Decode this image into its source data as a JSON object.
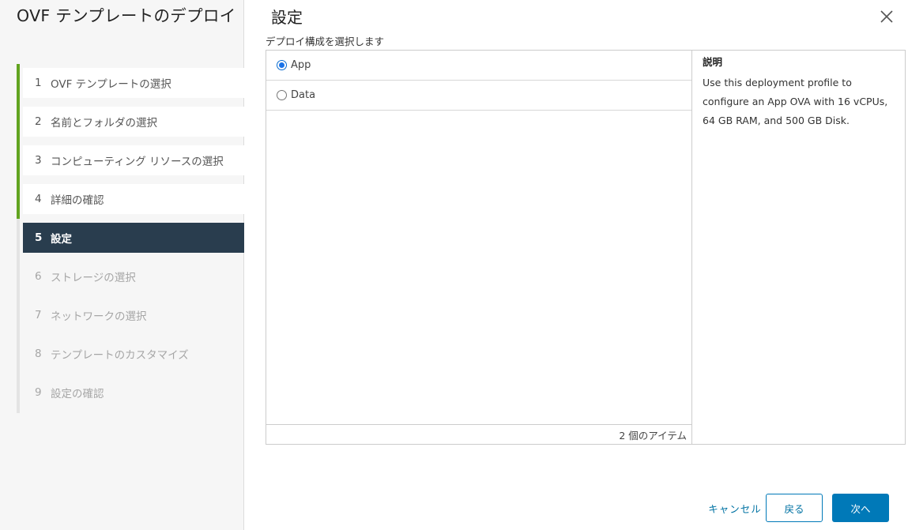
{
  "wizard": {
    "title": "OVF テンプレートのデプロイ"
  },
  "steps": [
    {
      "num": "1",
      "label": "OVF テンプレートの選択",
      "state": "completed"
    },
    {
      "num": "2",
      "label": "名前とフォルダの選択",
      "state": "completed"
    },
    {
      "num": "3",
      "label": "コンピューティング リソースの選択",
      "state": "completed"
    },
    {
      "num": "4",
      "label": "詳細の確認",
      "state": "completed"
    },
    {
      "num": "5",
      "label": "設定",
      "state": "current"
    },
    {
      "num": "6",
      "label": "ストレージの選択",
      "state": "upcoming"
    },
    {
      "num": "7",
      "label": "ネットワークの選択",
      "state": "upcoming"
    },
    {
      "num": "8",
      "label": "テンプレートのカスタマイズ",
      "state": "upcoming"
    },
    {
      "num": "9",
      "label": "設定の確認",
      "state": "upcoming"
    }
  ],
  "page": {
    "title": "設定",
    "instruction": "デプロイ構成を選択します"
  },
  "config": {
    "options": [
      {
        "label": "App",
        "selected": true
      },
      {
        "label": "Data",
        "selected": false
      }
    ],
    "item_count": "2 個のアイテム"
  },
  "description": {
    "heading": "説明",
    "text": "Use this deployment profile to configure an App OVA with 16 vCPUs, 64 GB RAM, and 500 GB Disk."
  },
  "buttons": {
    "cancel": "キャンセル",
    "back": "戻る",
    "next": "次へ"
  },
  "colors": {
    "completed_rail": "#62a420",
    "current_step_bg": "#293d4e",
    "primary": "#0079b8"
  },
  "icons": {
    "close": "close-icon"
  }
}
